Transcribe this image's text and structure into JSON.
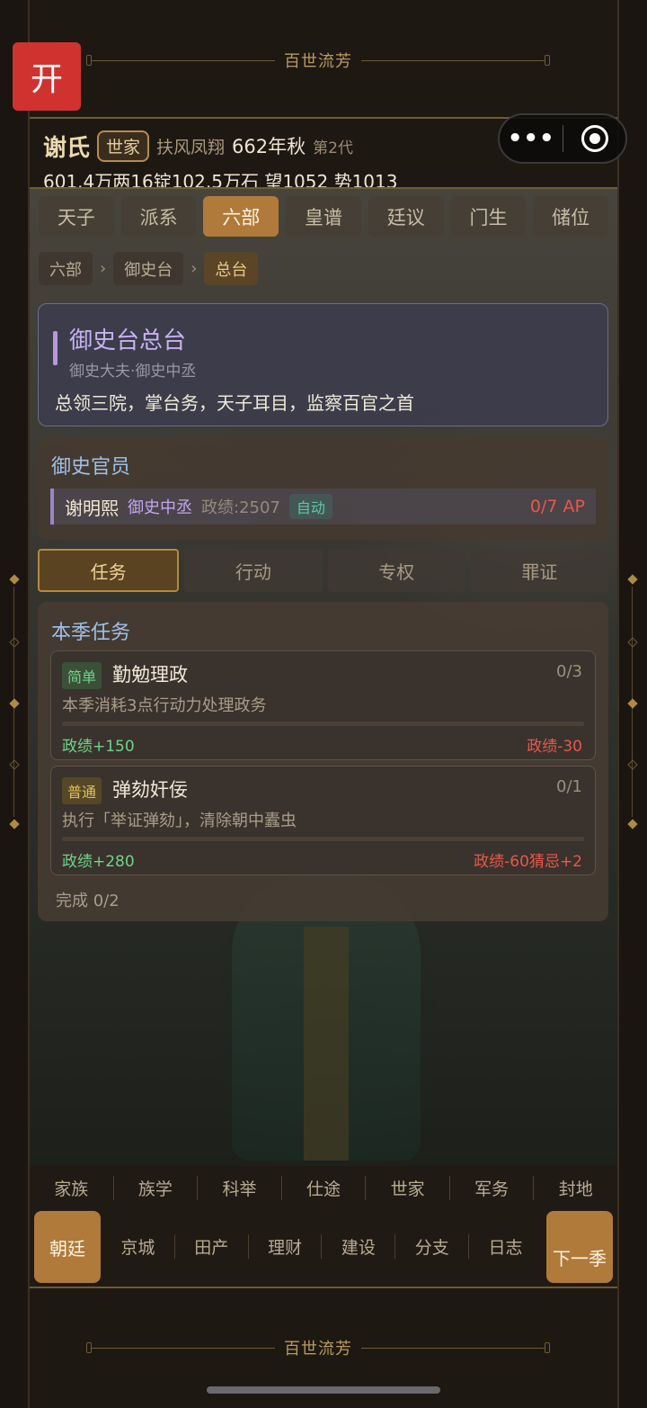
{
  "deco": {
    "top_title": "百世流芳",
    "bottom_title": "百世流芳"
  },
  "overlay": {
    "open_label": "开",
    "more_dots": "•••"
  },
  "header": {
    "clan": "谢氏",
    "badge": "世家",
    "motto": "扶风凤翔",
    "year": "662年秋",
    "generation": "第2代",
    "resources": "601.4万两16锭102.5万石  望1052 势1013"
  },
  "tabs": [
    {
      "label": "天子",
      "active": false
    },
    {
      "label": "派系",
      "active": false
    },
    {
      "label": "六部",
      "active": true
    },
    {
      "label": "皇谱",
      "active": false
    },
    {
      "label": "廷议",
      "active": false
    },
    {
      "label": "门生",
      "active": false
    },
    {
      "label": "储位",
      "active": false
    }
  ],
  "breadcrumb": {
    "items": [
      "六部",
      "御史台",
      "总台"
    ],
    "separator": "›"
  },
  "office": {
    "title": "御史台总台",
    "subtitle": "御史大夫·御史中丞",
    "description": "总领三院，掌台务，天子耳目，监察百官之首"
  },
  "officials": {
    "title": "御史官员",
    "rows": [
      {
        "name": "谢明熙",
        "position": "御史中丞",
        "performance": "政绩:2507",
        "mode": "自动",
        "ap": "0/7 AP"
      }
    ]
  },
  "subtabs": [
    {
      "label": "任务",
      "active": true
    },
    {
      "label": "行动",
      "active": false
    },
    {
      "label": "专权",
      "active": false
    },
    {
      "label": "罪证",
      "active": false
    }
  ],
  "tasks": {
    "title": "本季任务",
    "items": [
      {
        "difficulty": "简单",
        "level": "easy",
        "name": "勤勉理政",
        "count": "0/3",
        "progress": 0,
        "description": "本季消耗3点行动力处理政务",
        "reward": "政绩+150",
        "penalty": "政绩-30"
      },
      {
        "difficulty": "普通",
        "level": "normal",
        "name": "弹劾奸佞",
        "count": "0/1",
        "progress": 0,
        "description": "执行「举证弹劾」，清除朝中蠹虫",
        "reward": "政绩+280",
        "penalty": "政绩-60猜忌+2"
      }
    ],
    "completion": "完成 0/2"
  },
  "nav_top": [
    "家族",
    "族学",
    "科举",
    "仕途",
    "世家",
    "军务",
    "封地"
  ],
  "nav_bottom": {
    "active": "朝廷",
    "items": [
      "京城",
      "田产",
      "理财",
      "建设",
      "分支",
      "日志"
    ],
    "next": "下一季"
  },
  "colors": {
    "accent": "#b07a3a",
    "reward": "#6ed48a",
    "penalty": "#e8584c",
    "title_blue": "#9ec0e8",
    "office_purple": "#c8b2f0"
  }
}
